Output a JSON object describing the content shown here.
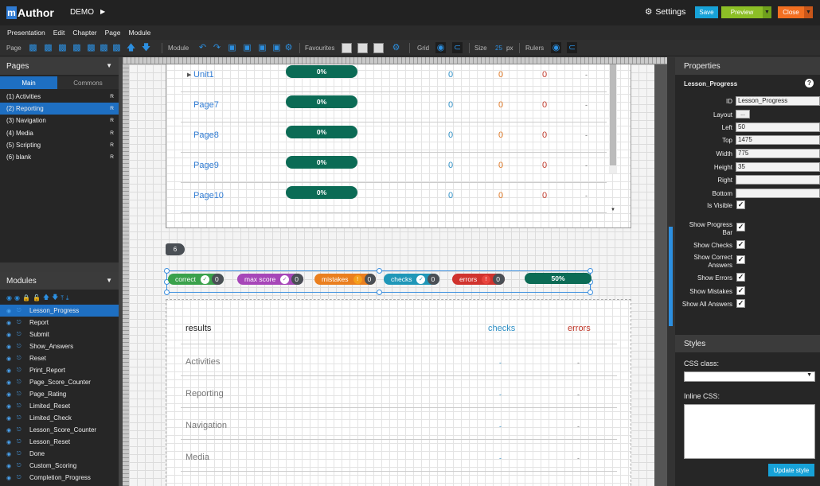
{
  "app": {
    "logo_m": "m",
    "logo_text": "Author",
    "project": "DEMO"
  },
  "topbar": {
    "settings": "Settings",
    "save": "Save",
    "preview": "Preview",
    "close": "Close"
  },
  "menu": [
    "Presentation",
    "Edit",
    "Chapter",
    "Page",
    "Module"
  ],
  "toolbar": {
    "page": "Page",
    "module": "Module",
    "favourites": "Favourites",
    "grid": "Grid",
    "size": "Size",
    "size_value": "25",
    "size_unit": "px",
    "rulers": "Rulers"
  },
  "pages_panel": {
    "title": "Pages",
    "tab_main": "Main",
    "tab_commons": "Commons",
    "items": [
      {
        "label": "(1) Activities",
        "flag": "R"
      },
      {
        "label": "(2) Reporting",
        "flag": "R"
      },
      {
        "label": "(3) Navigation",
        "flag": "R"
      },
      {
        "label": "(4) Media",
        "flag": "R"
      },
      {
        "label": "(5) Scripting",
        "flag": "R"
      },
      {
        "label": "(6) blank",
        "flag": "R"
      }
    ]
  },
  "modules_panel": {
    "title": "Modules",
    "items": [
      "Lesson_Progress",
      "Report",
      "Submit",
      "Show_Answers",
      "Reset",
      "Print_Report",
      "Page_Score_Counter",
      "Page_Rating",
      "Limited_Reset",
      "Limited_Check",
      "Lesson_Score_Counter",
      "Lesson_Reset",
      "Done",
      "Custom_Scoring",
      "Completion_Progress"
    ]
  },
  "report_rows": [
    {
      "name": "Unit1",
      "progress": "0%",
      "c1": "0",
      "c2": "0",
      "c3": "0",
      "c4": "-"
    },
    {
      "name": "Page7",
      "progress": "0%",
      "c1": "0",
      "c2": "0",
      "c3": "0",
      "c4": "-"
    },
    {
      "name": "Page8",
      "progress": "0%",
      "c1": "0",
      "c2": "0",
      "c3": "0",
      "c4": "-"
    },
    {
      "name": "Page9",
      "progress": "0%",
      "c1": "0",
      "c2": "0",
      "c3": "0",
      "c4": "-"
    },
    {
      "name": "Page10",
      "progress": "0%",
      "c1": "0",
      "c2": "0",
      "c3": "0",
      "c4": "-"
    }
  ],
  "page_badge": "6",
  "lesson_progress": {
    "correct": {
      "label": "correct",
      "count": "0",
      "color": "#3aa14b"
    },
    "max_score": {
      "label": "max score",
      "count": "0",
      "color": "#a646b8"
    },
    "mistakes": {
      "label": "mistakes",
      "count": "0",
      "color": "#ea7f1f"
    },
    "checks": {
      "label": "checks",
      "count": "0",
      "color": "#1f97b8"
    },
    "errors": {
      "label": "errors",
      "count": "0",
      "color": "#d0332e"
    },
    "percent": "50%"
  },
  "summary": {
    "head": "results",
    "col_checks": "checks",
    "col_errors": "errors",
    "rows": [
      {
        "name": "Activities",
        "v1": "-",
        "v2": "-"
      },
      {
        "name": "Reporting",
        "v1": "-",
        "v2": "-"
      },
      {
        "name": "Navigation",
        "v1": "-",
        "v2": "-"
      },
      {
        "name": "Media",
        "v1": "-",
        "v2": "-"
      }
    ]
  },
  "properties": {
    "title": "Properties",
    "component": "Lesson_Progress",
    "fields": {
      "id": {
        "label": "ID",
        "value": "Lesson_Progress"
      },
      "layout": {
        "label": "Layout",
        "value": "..."
      },
      "left": {
        "label": "Left",
        "value": "50"
      },
      "top": {
        "label": "Top",
        "value": "1475"
      },
      "width": {
        "label": "Width",
        "value": "775"
      },
      "height": {
        "label": "Height",
        "value": "35"
      },
      "right": {
        "label": "Right",
        "value": ""
      },
      "bottom": {
        "label": "Bottom",
        "value": ""
      }
    },
    "checks": [
      {
        "label": "Is Visible",
        "checked": true
      },
      {
        "label": "Show Progress Bar",
        "checked": true
      },
      {
        "label": "Show Checks",
        "checked": true
      },
      {
        "label": "Show Correct Answers",
        "checked": true
      },
      {
        "label": "Show Errors",
        "checked": true
      },
      {
        "label": "Show Mistakes",
        "checked": true
      },
      {
        "label": "Show All Answers",
        "checked": true
      }
    ]
  },
  "styles": {
    "title": "Styles",
    "css_class_label": "CSS class:",
    "inline_css_label": "Inline CSS:",
    "update_button": "Update style"
  }
}
